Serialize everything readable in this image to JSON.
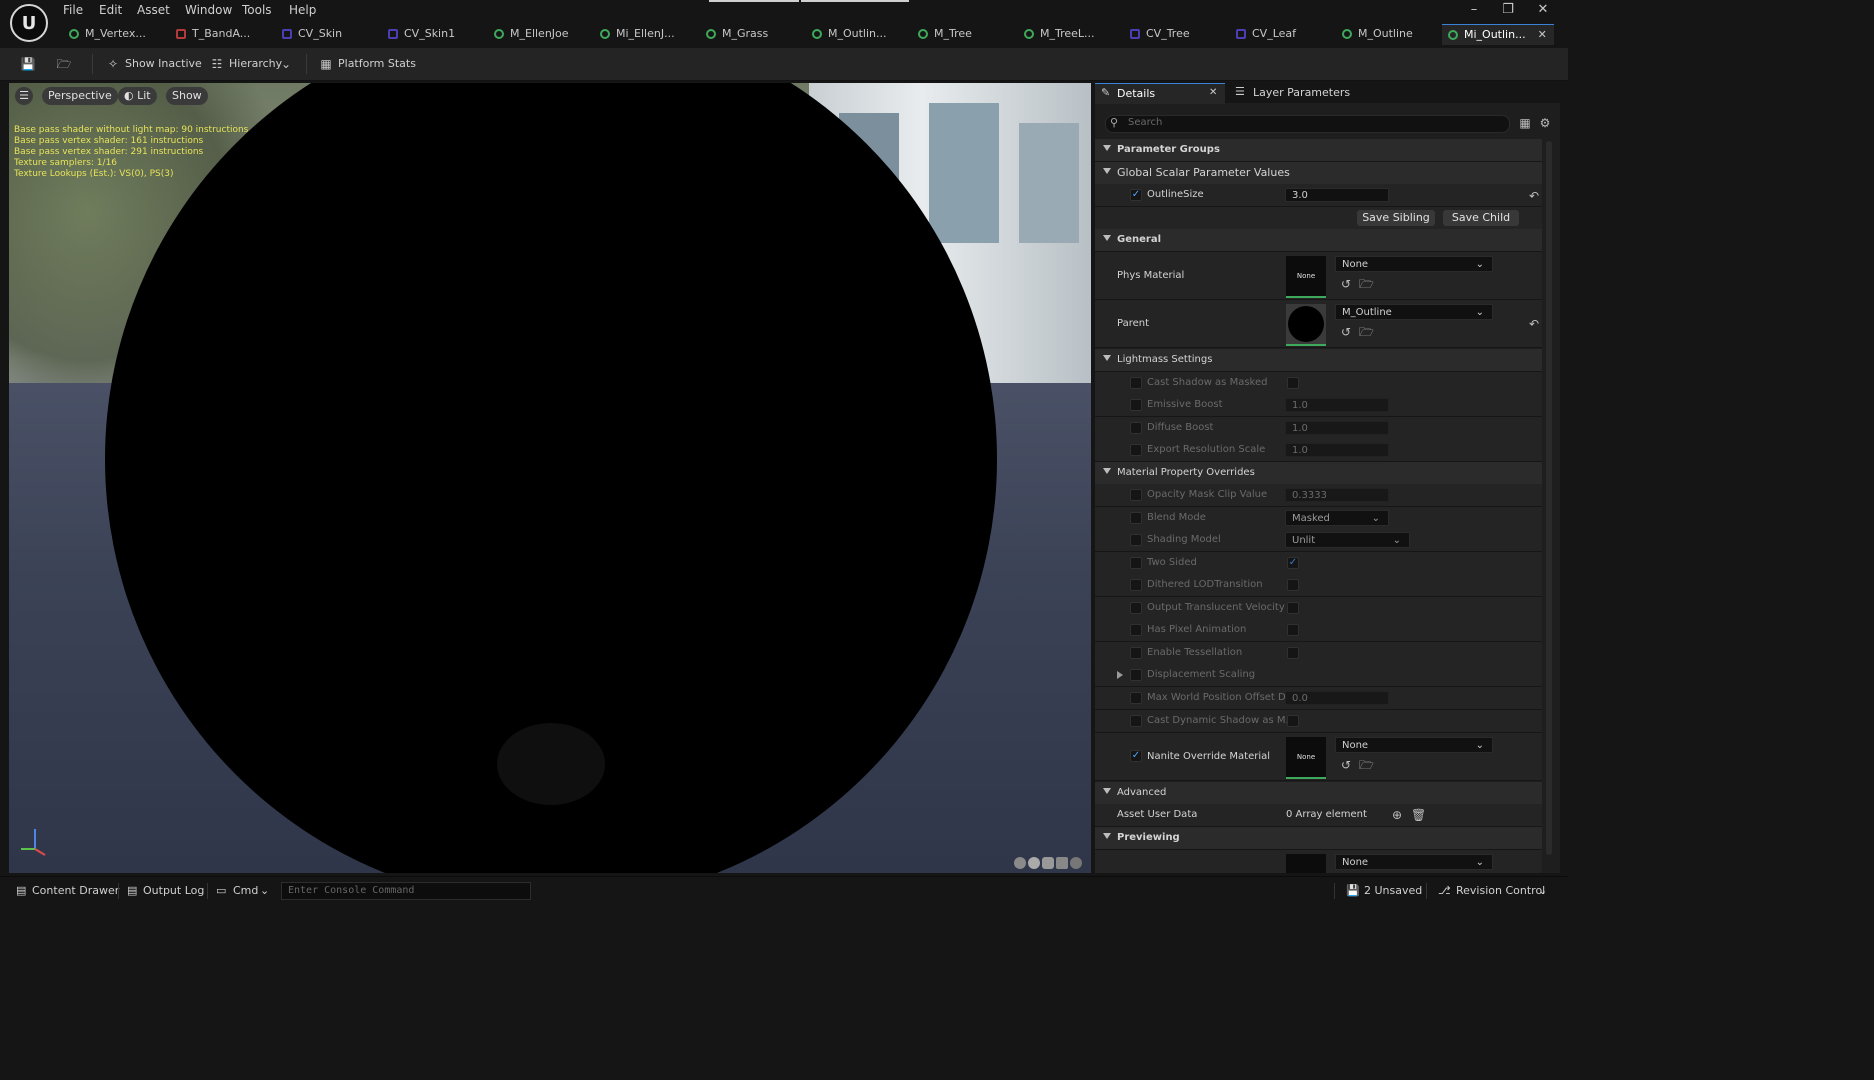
{
  "menu": [
    "File",
    "Edit",
    "Asset",
    "Window",
    "Tools",
    "Help"
  ],
  "tabs": [
    {
      "label": "M_Vertex...",
      "icon": "material-icon"
    },
    {
      "label": "T_BandA...",
      "icon": "texture-icon"
    },
    {
      "label": "CV_Skin",
      "icon": "curve-icon"
    },
    {
      "label": "CV_Skin1",
      "icon": "curve-icon"
    },
    {
      "label": "M_EllenJoe",
      "icon": "material-icon"
    },
    {
      "label": "Mi_EllenJ...",
      "icon": "material-instance-icon"
    },
    {
      "label": "M_Grass",
      "icon": "material-icon"
    },
    {
      "label": "M_Outlin...",
      "icon": "material-icon"
    },
    {
      "label": "M_Tree",
      "icon": "material-icon"
    },
    {
      "label": "M_TreeL...",
      "icon": "material-icon"
    },
    {
      "label": "CV_Tree",
      "icon": "curve-icon"
    },
    {
      "label": "CV_Leaf",
      "icon": "curve-icon"
    },
    {
      "label": "M_Outline",
      "icon": "material-icon"
    },
    {
      "label": "Mi_Outlin...",
      "icon": "material-instance-icon"
    }
  ],
  "toolbar": {
    "show_inactive": "Show Inactive",
    "hierarchy": "Hierarchy",
    "platform_stats": "Platform Stats"
  },
  "viewport": {
    "perspective": "Perspective",
    "lit": "Lit",
    "show": "Show",
    "stats": [
      "Base pass shader without light map: 90 instructions",
      "Base pass vertex shader: 161 instructions",
      "Base pass vertex shader: 291 instructions",
      "Texture samplers: 1/16",
      "Texture Lookups (Est.): VS(0), PS(3)"
    ]
  },
  "details": {
    "tab_details": "Details",
    "tab_layer": "Layer Parameters",
    "search_placeholder": "Search",
    "parameter_groups": "Parameter Groups",
    "global_scalar": "Global Scalar Parameter Values",
    "outline_size_label": "OutlineSize",
    "outline_size_value": "3.0",
    "save_sibling": "Save Sibling",
    "save_child": "Save Child",
    "general": "General",
    "phys_material": "Phys Material",
    "phys_value": "None",
    "thumb_none": "None",
    "parent": "Parent",
    "parent_value": "M_Outline",
    "lightmass": "Lightmass Settings",
    "cast_shadow_masked": "Cast Shadow as Masked",
    "emissive_boost": "Emissive Boost",
    "emissive_value": "1.0",
    "diffuse_boost": "Diffuse Boost",
    "diffuse_value": "1.0",
    "export_res": "Export Resolution Scale",
    "export_value": "1.0",
    "mpo": "Material Property Overrides",
    "opacity_mask": "Opacity Mask Clip Value",
    "opacity_value": "0.3333",
    "blend_mode": "Blend Mode",
    "blend_value": "Masked",
    "shading_model": "Shading Model",
    "shading_value": "Unlit",
    "two_sided": "Two Sided",
    "dithered": "Dithered LODTransition",
    "output_velocity": "Output Translucent Velocity",
    "pixel_anim": "Has Pixel Animation",
    "tessellation": "Enable Tessellation",
    "displacement": "Displacement Scaling",
    "max_wpo": "Max World Position Offset Di...",
    "max_wpo_value": "0.0",
    "cast_dynamic": "Cast Dynamic Shadow as M...",
    "nanite": "Nanite Override Material",
    "nanite_value": "None",
    "advanced": "Advanced",
    "asset_user_data": "Asset User Data",
    "asset_user_value": "0 Array element",
    "previewing": "Previewing",
    "preview_value": "None"
  },
  "status": {
    "content_drawer": "Content Drawer",
    "output_log": "Output Log",
    "cmd": "Cmd",
    "console_placeholder": "Enter Console Command",
    "unsaved": "2 Unsaved",
    "revision": "Revision Control"
  }
}
